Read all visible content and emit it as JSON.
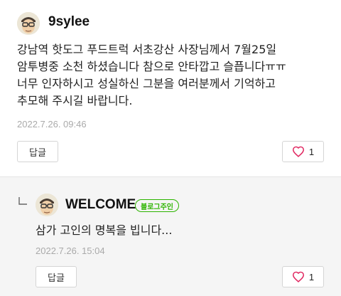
{
  "comments": [
    {
      "username": "9sylee",
      "text": "강남역 핫도그 푸드트럭 서초강산 사장님께서 7월25일\n암투병중 소천 하셨습니다 참으로 안타깝고 슬픕니다ㅠㅠ\n너무 인자하시고 성실하신 그분을 여러분께서 기억하고\n추모해 주시길 바랍니다.",
      "timestamp": "2022.7.26. 09:46",
      "reply_label": "답글",
      "like_count": "1"
    },
    {
      "username": "WELCOME",
      "badge": "블로그주인",
      "text": "삼가 고인의 명복을 빕니다...",
      "timestamp": "2022.7.26. 15:04",
      "reply_label": "답글",
      "like_count": "1"
    }
  ],
  "colors": {
    "badge": "#2db400",
    "heart": "#e0245e",
    "reply_bg": "#f5f5f5"
  }
}
